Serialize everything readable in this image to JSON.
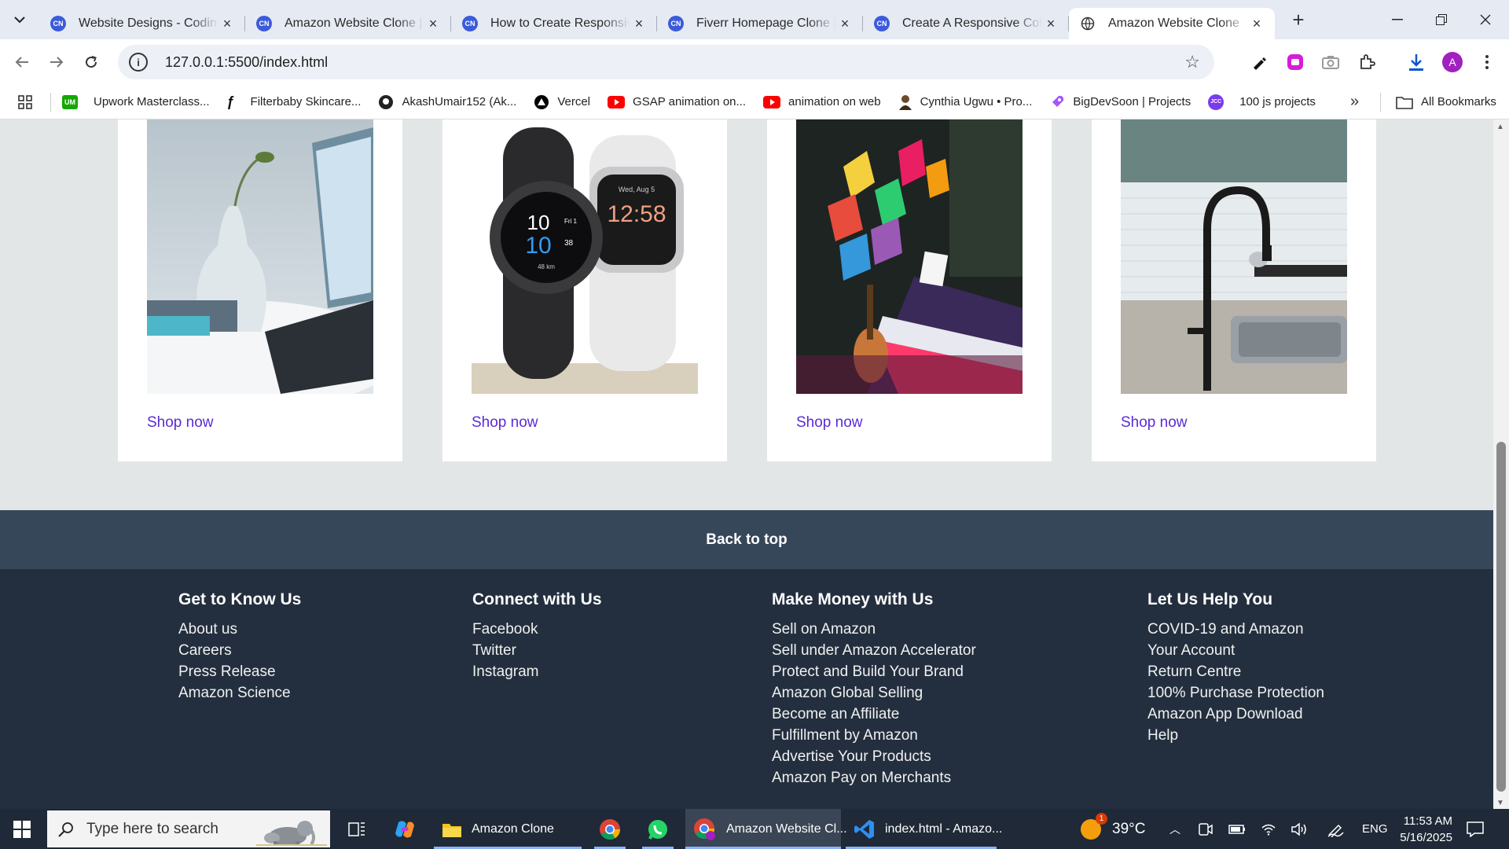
{
  "tabs": [
    {
      "title": "Website Designs - CodingN",
      "active": false
    },
    {
      "title": "Amazon Website Clone | Cc",
      "active": false
    },
    {
      "title": "How to Create Responsive",
      "active": false
    },
    {
      "title": "Fiverr Homepage Clone | C",
      "active": false
    },
    {
      "title": "Create A Responsive Coffe",
      "active": false
    },
    {
      "title": "Amazon Website Clone",
      "active": true
    }
  ],
  "address_bar": {
    "url": "127.0.0.1:5500/index.html"
  },
  "profile_initial": "A",
  "bookmarks": [
    {
      "label": "Upwork Masterclass...",
      "icon": "UM",
      "color": "#14a800"
    },
    {
      "label": "Filterbaby Skincare...",
      "icon": "F",
      "color": "#ffffff"
    },
    {
      "label": "AkashUmair152 (Ak...",
      "icon": "github-icon",
      "color": "#222222"
    },
    {
      "label": "Vercel",
      "icon": "vercel-icon",
      "color": "#000000"
    },
    {
      "label": "GSAP animation on...",
      "icon": "youtube-icon",
      "color": "#ff0000"
    },
    {
      "label": "animation on web",
      "icon": "youtube-icon",
      "color": "#ff0000"
    },
    {
      "label": "Cynthia Ugwu • Pro...",
      "icon": "avatar-icon",
      "color": "#6b4a2b"
    },
    {
      "label": "BigDevSoon | Projects",
      "icon": "rocket-icon",
      "color": "#a855f7"
    },
    {
      "label": "100 js projects",
      "icon": "JCC",
      "color": "#7c3aed"
    }
  ],
  "all_bookmarks_label": "All Bookmarks",
  "products": [
    {
      "image": "vase-laptop",
      "link": "Shop now"
    },
    {
      "image": "smartwatches",
      "link": "Shop now"
    },
    {
      "image": "music-lights",
      "link": "Shop now"
    },
    {
      "image": "kitchen-faucet",
      "link": "Shop now"
    }
  ],
  "watch_texts": {
    "small_time": "10",
    "small_day": "Fri 1",
    "big_time": "10",
    "seconds": "38",
    "distance": "48 km",
    "date": "Wed, Aug 5",
    "white_time": "12:58"
  },
  "back_to_top": "Back to top",
  "footer": [
    {
      "heading": "Get to Know Us",
      "links": [
        "About us",
        "Careers",
        "Press Release",
        "Amazon Science"
      ]
    },
    {
      "heading": "Connect with Us",
      "links": [
        "Facebook",
        "Twitter",
        "Instagram"
      ]
    },
    {
      "heading": "Make Money with Us",
      "links": [
        "Sell on Amazon",
        "Sell under Amazon Accelerator",
        "Protect and Build Your Brand",
        "Amazon Global Selling",
        "Become an Affiliate",
        "Fulfillment by Amazon",
        "Advertise Your Products",
        "Amazon Pay on Merchants"
      ]
    },
    {
      "heading": "Let Us Help You",
      "links": [
        "COVID-19 and Amazon",
        "Your Account",
        "Return Centre",
        "100% Purchase Protection",
        "Amazon App Download",
        "Help"
      ]
    }
  ],
  "taskbar": {
    "search_placeholder": "Type here to search",
    "apps": [
      {
        "label": "Amazon Clone",
        "icon": "folder-icon"
      },
      {
        "label": "",
        "icon": "chrome-icon"
      },
      {
        "label": "",
        "icon": "whatsapp-icon"
      },
      {
        "label": "Amazon Website Cl...",
        "icon": "chrome-profile-icon"
      },
      {
        "label": "index.html - Amazo...",
        "icon": "vscode-icon"
      }
    ],
    "weather_badge": "1",
    "temperature": "39°C",
    "language": "ENG",
    "time": "11:53 AM",
    "date": "5/16/2025"
  }
}
